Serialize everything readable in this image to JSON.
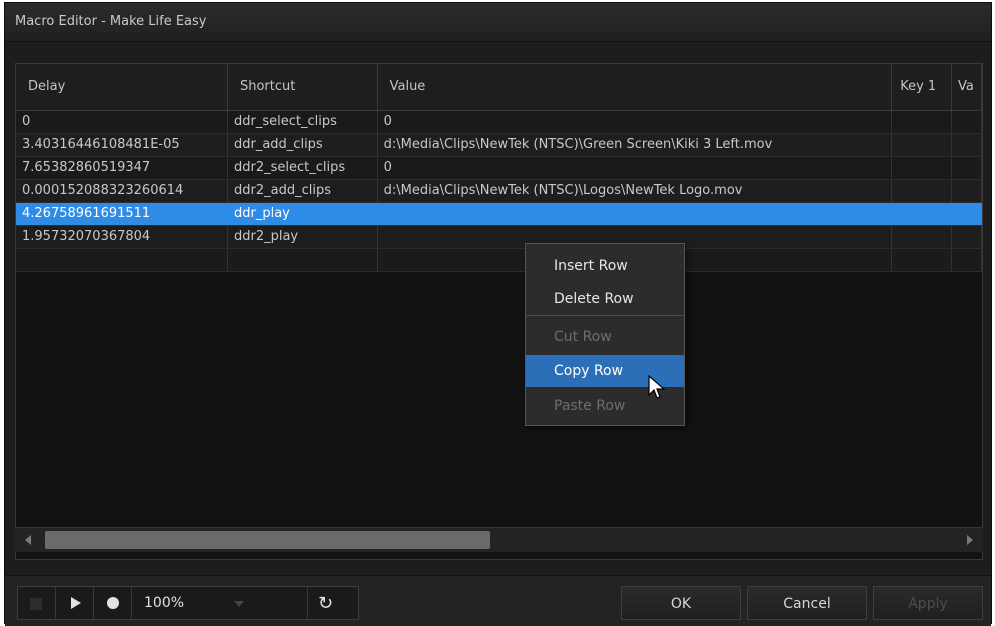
{
  "window": {
    "title": "Macro Editor - Make Life Easy"
  },
  "table": {
    "columns": [
      "Delay",
      "Shortcut",
      "Value",
      "Key 1",
      "Va"
    ],
    "rows": [
      [
        "0",
        "ddr_select_clips",
        "0",
        "",
        ""
      ],
      [
        "3.40316446108481E-05",
        "ddr_add_clips",
        "d:\\Media\\Clips\\NewTek (NTSC)\\Green Screen\\Kiki 3 Left.mov",
        "",
        ""
      ],
      [
        "7.65382860519347",
        "ddr2_select_clips",
        "0",
        "",
        ""
      ],
      [
        "0.000152088323260614",
        "ddr2_add_clips",
        "d:\\Media\\Clips\\NewTek (NTSC)\\Logos\\NewTek Logo.mov",
        "",
        ""
      ],
      [
        "4.26758961691511",
        "ddr_play",
        "",
        "",
        ""
      ],
      [
        "1.95732070367804",
        "ddr2_play",
        "",
        "",
        ""
      ]
    ],
    "selected_row": 4
  },
  "context_menu": {
    "items": [
      {
        "label": "Insert Row",
        "enabled": true
      },
      {
        "label": "Delete Row",
        "enabled": true
      },
      {
        "label": "Cut Row",
        "enabled": false
      },
      {
        "label": "Copy Row",
        "enabled": true,
        "hovered": true
      },
      {
        "label": "Paste Row",
        "enabled": false
      }
    ]
  },
  "toolbar": {
    "zoom": "100%",
    "ok_label": "OK",
    "cancel_label": "Cancel",
    "apply_label": "Apply"
  },
  "colors": {
    "selection": "#2f8ce6",
    "menu_hover": "#2a6fb8"
  }
}
